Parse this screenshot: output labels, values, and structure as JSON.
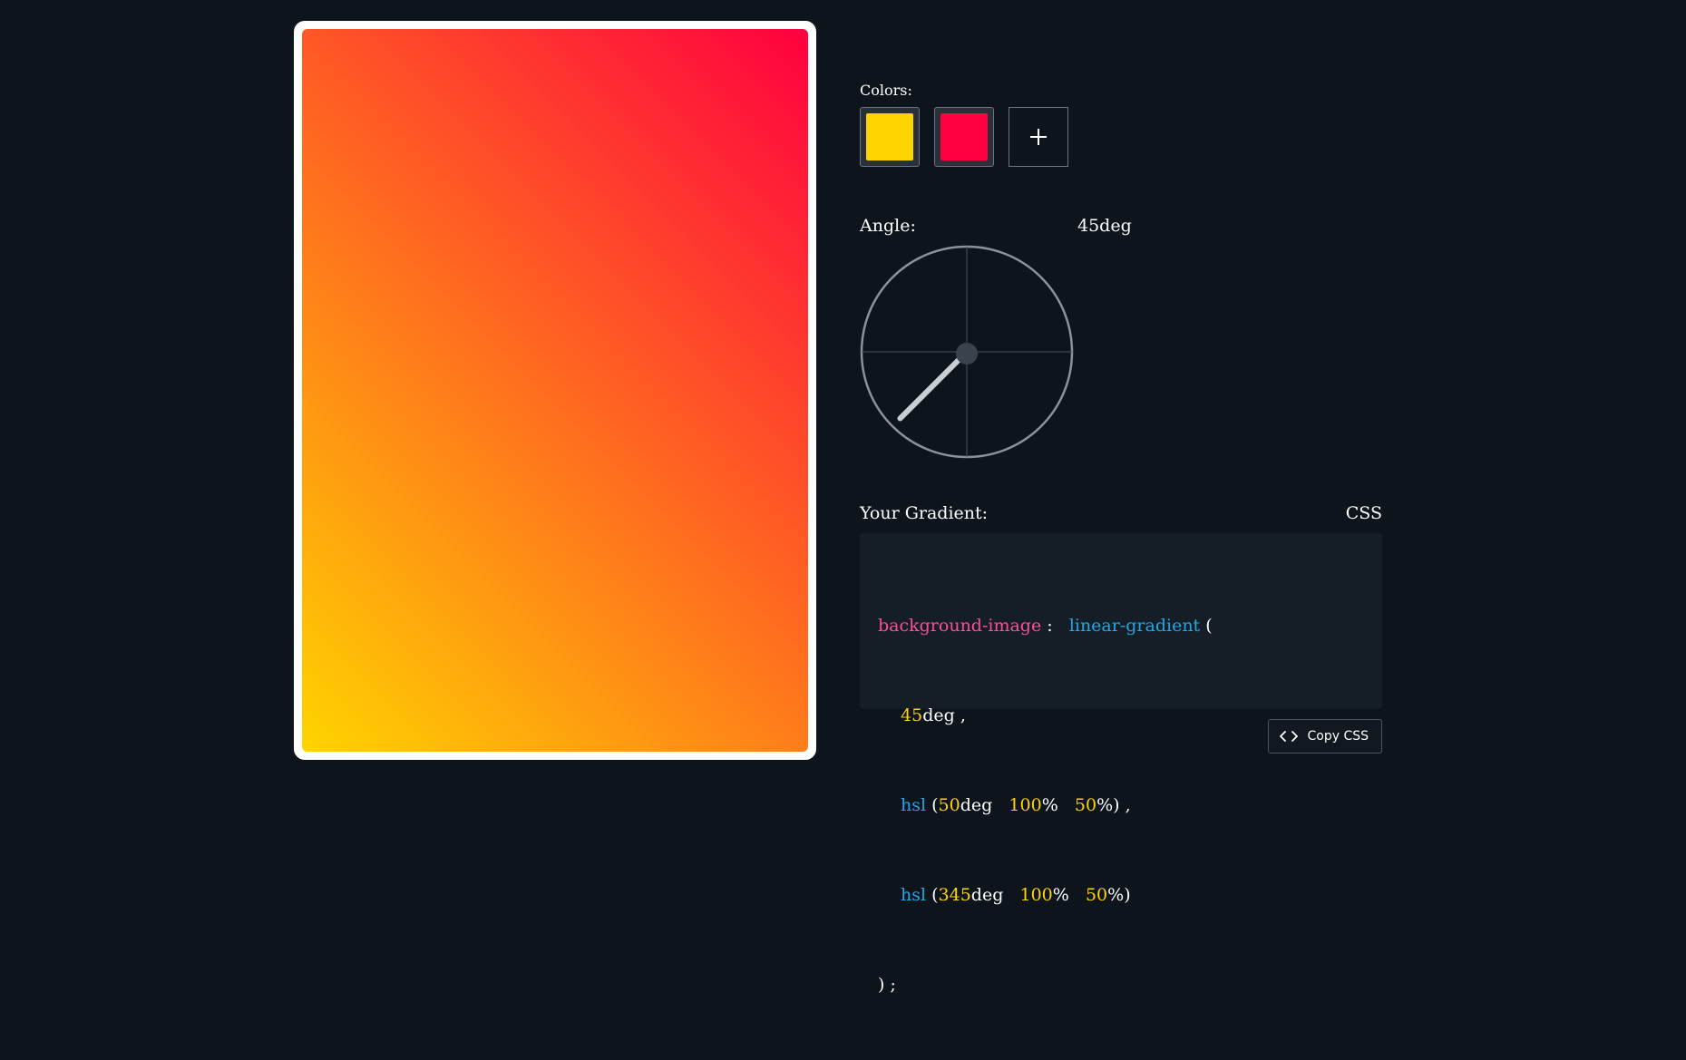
{
  "preview": {
    "angle_deg": 45,
    "stops": [
      "hsl(50deg 100% 50%)",
      "hsl(345deg 100% 50%)"
    ]
  },
  "colors": {
    "label": "Colors:",
    "swatches": [
      {
        "name": "yellow",
        "hex": "#ffd500"
      },
      {
        "name": "red",
        "hex": "#ff0040"
      }
    ],
    "add_icon": "plus-icon"
  },
  "angle": {
    "label": "Angle:",
    "value_text": "45deg",
    "degrees": 45
  },
  "output": {
    "label": "Your Gradient:",
    "language": "CSS",
    "code": {
      "property": "background-image",
      "colon": ":",
      "function": "linear-gradient",
      "open_paren": "(",
      "angle_num": "45",
      "angle_unit": "deg",
      "comma": ",",
      "stop1": {
        "fn": "hsl",
        "h": "50",
        "h_unit": "deg",
        "s": "100",
        "l": "50",
        "pct": "%",
        "close": ")",
        "sep": ","
      },
      "stop2": {
        "fn": "hsl",
        "h": "345",
        "h_unit": "deg",
        "s": "100",
        "l": "50",
        "pct": "%",
        "close": ")"
      },
      "closing": ") ;"
    }
  },
  "copy_button": {
    "label": "Copy CSS",
    "icon": "code-icon"
  },
  "theme": {
    "background": "#0e141c",
    "code_bg": "#151e27",
    "property_color": "#ff4d9a",
    "function_color": "#1fa8e8",
    "number_color": "#ffd400"
  }
}
